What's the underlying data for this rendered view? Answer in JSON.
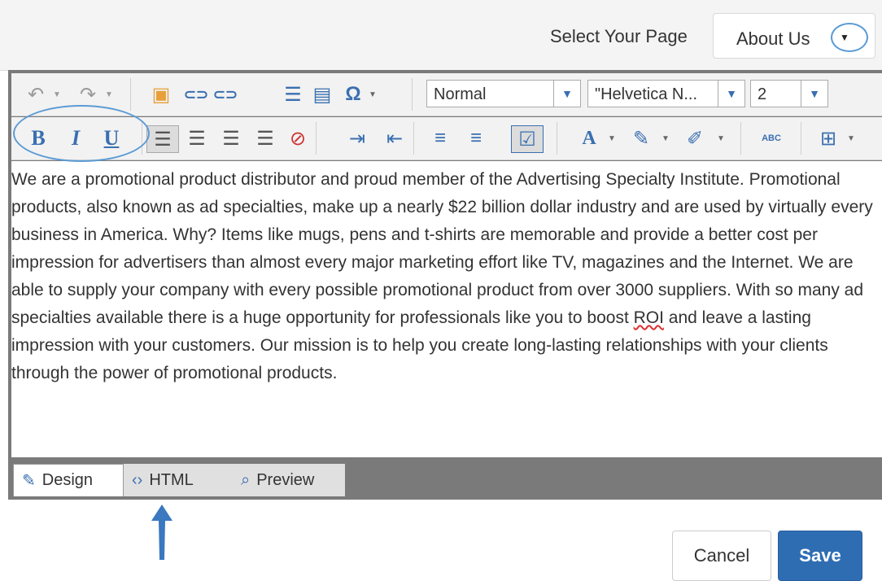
{
  "header": {
    "select_label": "Select Your Page",
    "page_value": "About Us"
  },
  "toolbar": {
    "style_value": "Normal",
    "font_value": "\"Helvetica N...",
    "size_value": "2",
    "bold": "B",
    "italic": "I",
    "underline": "U",
    "omega": "Ω",
    "spell": "ABC"
  },
  "content": {
    "text_before": "We are a promotional product distributor and proud member of the Advertising Specialty Institute. Promotional products, also known as ad specialties, make up a nearly $22 billion dollar industry and are used by virtually every business in America. Why? Items like mugs, pens and t-shirts are memorable and provide a better cost per impression for advertisers than almost every major marketing effort like TV, magazines and the Internet. We are able to supply your company with every possible promotional product from over 3000 suppliers. With so many ad specialties available there is a huge opportunity for professionals like you to boost ",
    "roi": "ROI",
    "text_after": " and leave a lasting impression with your customers. Our mission is to help you create long-lasting relationships with your clients through the power of promotional products."
  },
  "tabs": [
    {
      "label": "Design"
    },
    {
      "label": "HTML"
    },
    {
      "label": "Preview"
    }
  ],
  "footer": {
    "cancel_label": "Cancel",
    "save_label": "Save"
  },
  "colors": {
    "accent": "#5b9bd5",
    "save_button": "#2f6db3",
    "toolbar_bg": "#f2f2f2",
    "editor_frame": "#7a7a7a"
  }
}
